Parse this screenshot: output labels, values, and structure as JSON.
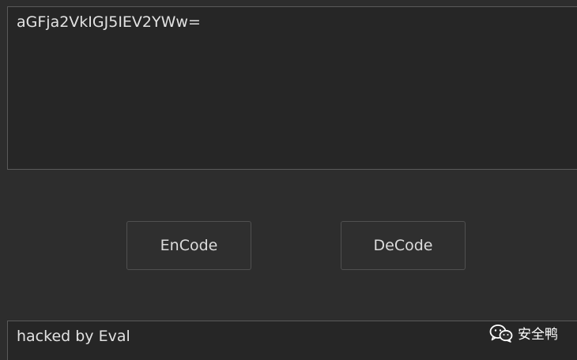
{
  "input": {
    "value": "aGFja2VkIGJ5IEV2YWw="
  },
  "buttons": {
    "encode_label": "EnCode",
    "decode_label": "DeCode"
  },
  "output": {
    "value": "hacked by Eval"
  },
  "watermark": {
    "text": "安全鸭",
    "icon": "wechat-icon"
  },
  "colors": {
    "background": "#2d2d2d",
    "field": "#262626",
    "border": "#5a5a5a",
    "text": "#e2e2e2"
  }
}
